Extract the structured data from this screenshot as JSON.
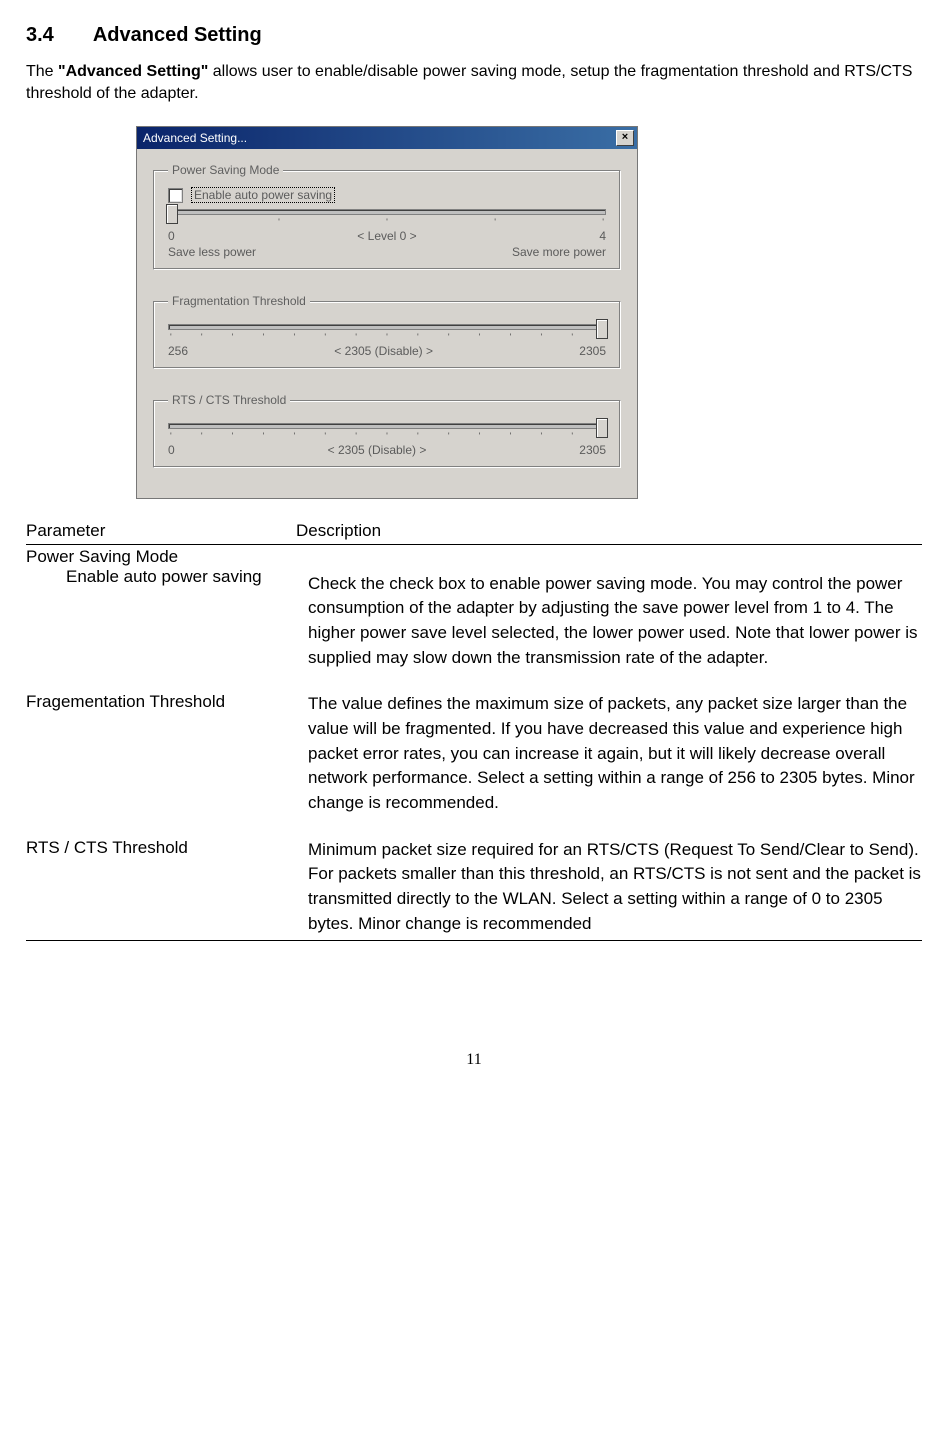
{
  "heading_number": "3.4",
  "heading_text": "Advanced Setting",
  "intro_before_bold": "The ",
  "intro_bold": "\"Advanced Setting\"",
  "intro_after_bold": " allows user to enable/disable power saving mode, setup the fragmentation threshold and RTS/CTS threshold of the adapter.",
  "dialog": {
    "title": "Advanced Setting...",
    "close_glyph": "×",
    "power_saving": {
      "legend": "Power Saving Mode",
      "checkbox_label": "Enable auto power saving",
      "min": "0",
      "center": "< Level 0 >",
      "max": "4",
      "left_text": "Save less power",
      "right_text": "Save more power"
    },
    "fragmentation": {
      "legend": "Fragmentation Threshold",
      "min": "256",
      "center": "< 2305 (Disable) >",
      "max": "2305"
    },
    "rts": {
      "legend": "RTS / CTS Threshold",
      "min": "0",
      "center": "< 2305 (Disable) >",
      "max": "2305"
    }
  },
  "table": {
    "header_param": "Parameter",
    "header_desc": "Description",
    "row1_section": "Power Saving Mode",
    "row1_sub_param": "Enable auto power saving",
    "row1_desc": "Check the check box to enable power saving mode. You may control the power consumption of the adapter by adjusting the save power level from 1 to 4. The higher power save level selected, the lower power used. Note that lower power is supplied may slow down the transmission rate of the adapter.",
    "row2_param": "Fragementation Threshold",
    "row2_desc": "The value defines the maximum size of packets, any packet size larger than the value will be fragmented. If you have decreased this value and experience high packet error rates, you can increase it again, but it will likely decrease overall network performance. Select a setting within a range of 256 to 2305 bytes. Minor change is recommended.",
    "row3_param": "RTS / CTS Threshold",
    "row3_desc": "Minimum packet size required for an RTS/CTS (Request To Send/Clear to Send). For packets smaller than this threshold, an RTS/CTS is not sent and the packet is transmitted directly to the WLAN. Select a setting within a range of 0 to 2305 bytes. Minor change is recommended"
  },
  "page_number": "11"
}
